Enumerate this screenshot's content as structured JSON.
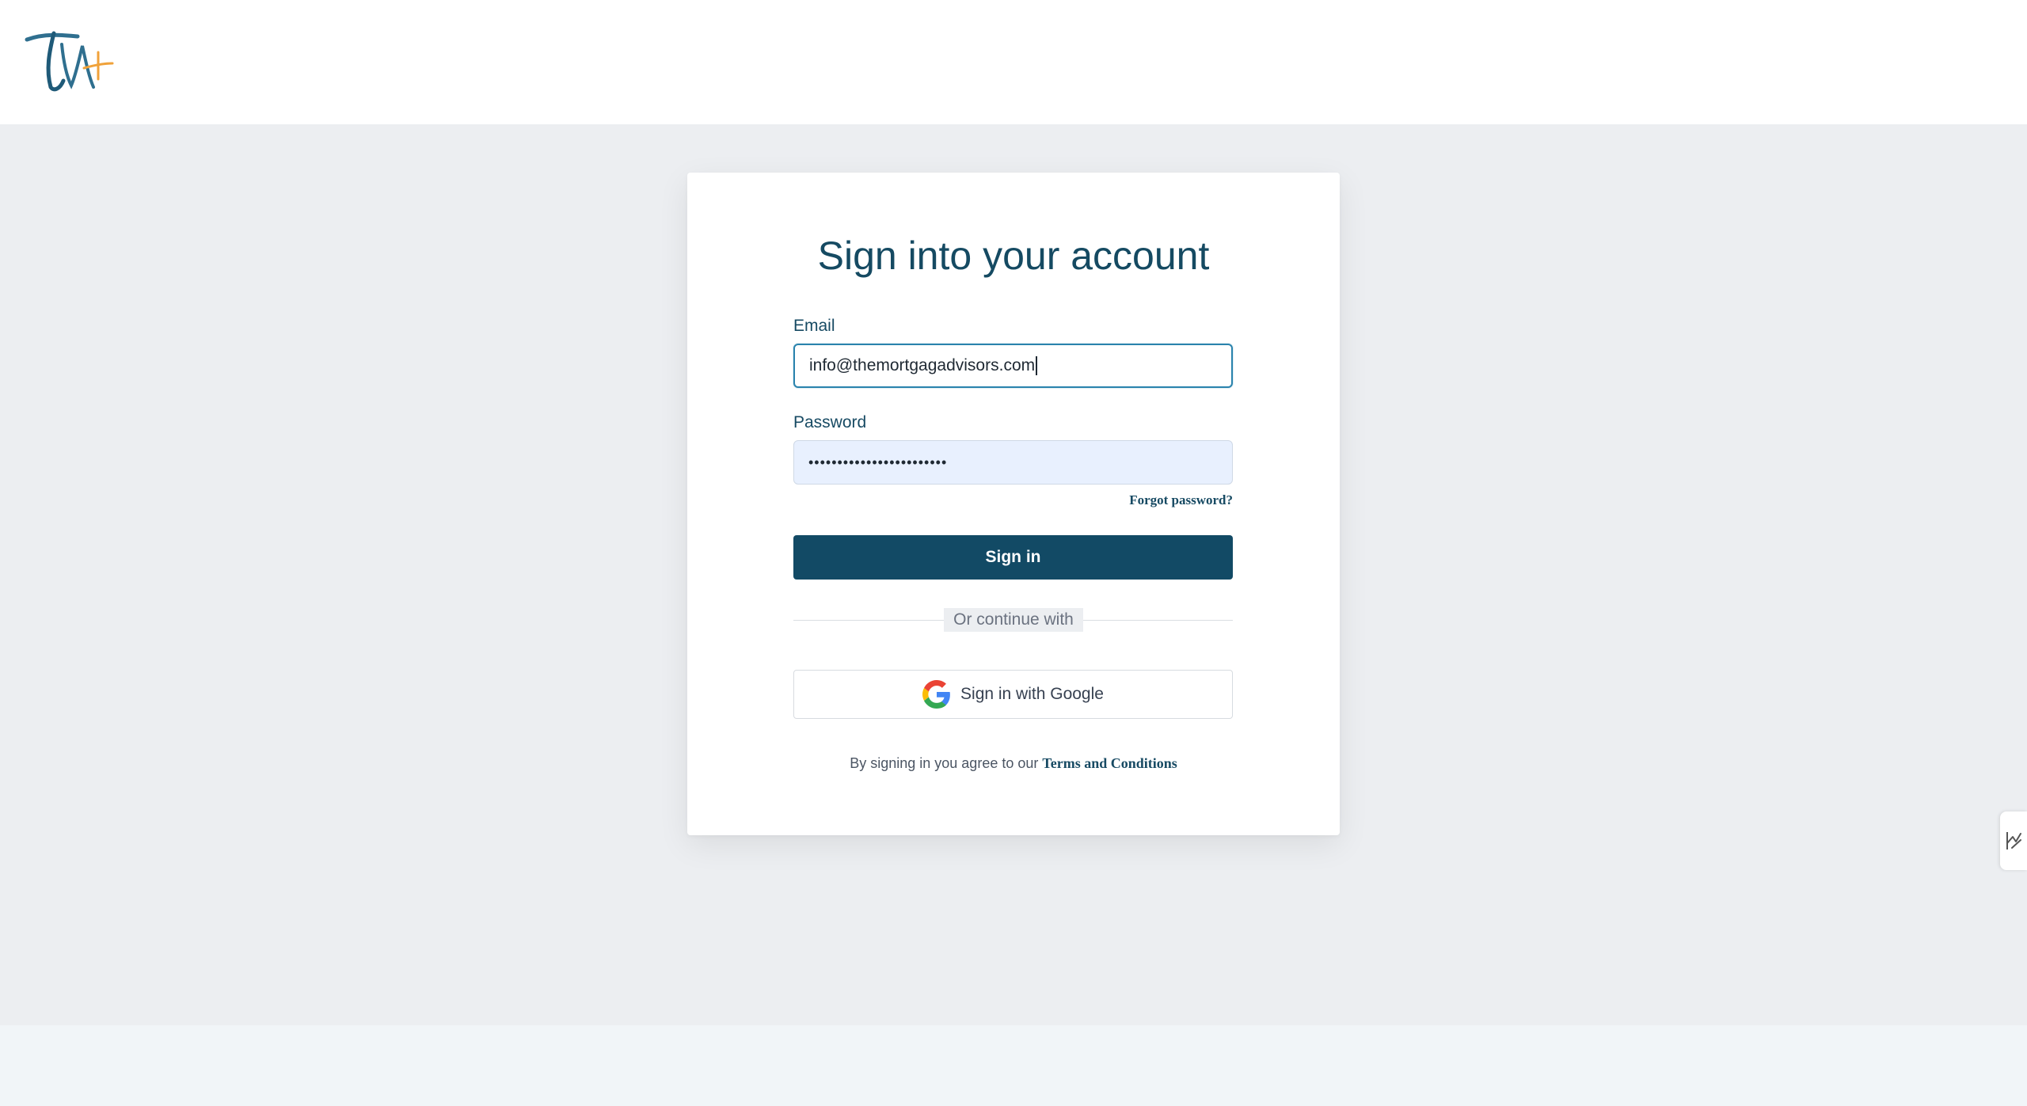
{
  "header": {
    "logo_icon": "tma-logo",
    "logo_text": "TM",
    "colors": {
      "primary": "#154a62",
      "accent": "#f0a23a"
    }
  },
  "login": {
    "title": "Sign into your account",
    "email_label": "Email",
    "email_value": "info@themortgagadvisors.com",
    "password_label": "Password",
    "password_value": "••••••••••••••••••••••••",
    "forgot_label": "Forgot password?",
    "signin_label": "Sign in",
    "divider_label": "Or continue with",
    "google_label": "Sign in with Google",
    "google_icon": "google-g-icon",
    "terms_prefix": "By signing in you agree to our ",
    "terms_link": "Terms and Conditions"
  },
  "side_widget": {
    "icon": "chart-line-icon"
  }
}
